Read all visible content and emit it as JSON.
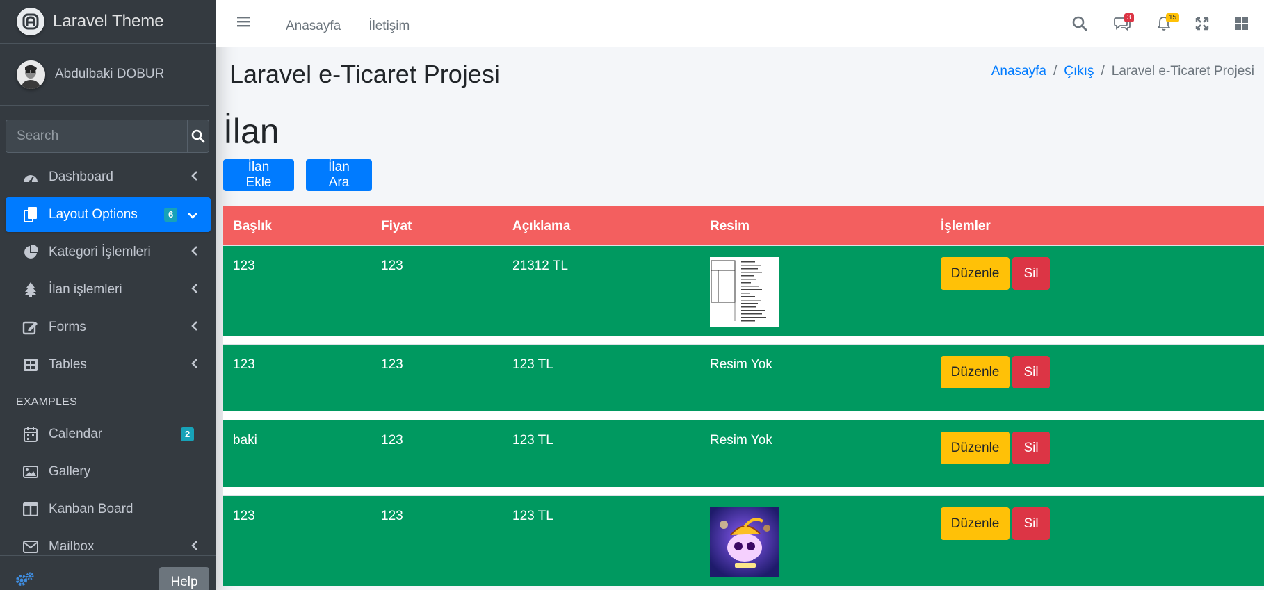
{
  "brand": {
    "title": "Laravel Theme"
  },
  "user": {
    "name": "Abdulbaki DOBUR"
  },
  "search": {
    "placeholder": "Search"
  },
  "sidebar": {
    "items": [
      {
        "label": "Dashboard",
        "icon": "tachometer-icon"
      },
      {
        "label": "Layout Options",
        "icon": "copy-icon",
        "badge": "6",
        "active": true
      },
      {
        "label": "Kategori İşlemleri",
        "icon": "pie-chart-icon"
      },
      {
        "label": "İlan işlemleri",
        "icon": "tree-icon"
      },
      {
        "label": "Forms",
        "icon": "edit-icon"
      },
      {
        "label": "Tables",
        "icon": "table-icon"
      }
    ],
    "header": "EXAMPLES",
    "examples": [
      {
        "label": "Calendar",
        "icon": "calendar-icon",
        "badge": "2"
      },
      {
        "label": "Gallery",
        "icon": "image-icon"
      },
      {
        "label": "Kanban Board",
        "icon": "columns-icon"
      },
      {
        "label": "Mailbox",
        "icon": "envelope-icon"
      }
    ],
    "help": "Help"
  },
  "topbar": {
    "links": [
      "Anasayfa",
      "İletişim"
    ],
    "messages_badge": "3",
    "notifications_badge": "15"
  },
  "content": {
    "title": "Laravel e-Ticaret Projesi",
    "breadcrumb": [
      "Anasayfa",
      "Çıkış",
      "Laravel e-Ticaret Projesi"
    ],
    "section_title": "İlan",
    "add_button": "İlan Ekle",
    "search_button": "İlan Ara"
  },
  "table": {
    "headers": [
      "Başlık",
      "Fiyat",
      "Açıklama",
      "Resim",
      "İşlemler"
    ],
    "edit_label": "Düzenle",
    "delete_label": "Sil",
    "rows": [
      {
        "baslik": "123",
        "fiyat": "123",
        "aciklama": "21312 TL",
        "resim": ""
      },
      {
        "baslik": "123",
        "fiyat": "123",
        "aciklama": "123 TL",
        "resim": "Resim Yok"
      },
      {
        "baslik": "baki",
        "fiyat": "123",
        "aciklama": "123 TL",
        "resim": "Resim Yok"
      },
      {
        "baslik": "123",
        "fiyat": "123",
        "aciklama": "123 TL",
        "resim": ""
      }
    ]
  },
  "colors": {
    "sidebar_bg": "#343a40",
    "primary": "#007bff",
    "table_header": "#f35f5f",
    "table_row": "#009960",
    "warning": "#ffc107",
    "danger": "#dc3545"
  }
}
